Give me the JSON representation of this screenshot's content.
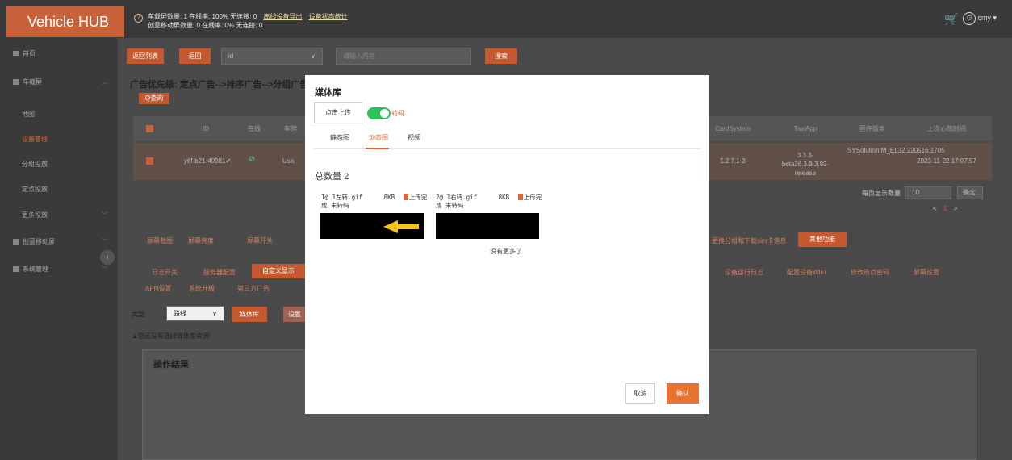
{
  "header": {
    "brand": "Vehicle HUB",
    "stats_line1_text": "车载屏数量: 1  在线率: 100%  无连接: 0",
    "stats_line1_link1": "离线设备导出",
    "stats_line1_link2": "设备状态统计",
    "stats_line2": "创意移动屏数量: 0  在线率: 0%  无连接: 0",
    "user_name": "cmy"
  },
  "sidebar": {
    "items": [
      {
        "label": "首页"
      },
      {
        "label": "车载屏"
      },
      {
        "label": "地图"
      },
      {
        "label": "设备管理"
      },
      {
        "label": "分组投放"
      },
      {
        "label": "定点投放"
      },
      {
        "label": "更多投放"
      },
      {
        "label": "创意移动屏"
      },
      {
        "label": "系统管理"
      }
    ]
  },
  "toolbar": {
    "reset_label": "返回列表",
    "back_label": "返回",
    "field_select": "id",
    "search_placeholder": "请输入内容",
    "search_label": "搜索"
  },
  "main": {
    "title": "广告优先级: 定点广告-->排序广告-->分组广告",
    "query_tag": "Q查询",
    "columns": [
      "ID",
      "在线",
      "车牌",
      "CardSystem",
      "TaxiApp",
      "固件版本",
      "上次心跳时间"
    ],
    "row": {
      "id": "y6f-b21-40981✔",
      "plate": "Usa",
      "card_system": "5.2.7.1-3",
      "taxi_app": "3.3.3-beta26.3.9.3.93-release",
      "firmware": "SYSolution.M_EL32.220516.1705",
      "heartbeat": "2023-11-22 17:07:57"
    },
    "pager": {
      "per_page_label": "每页显示数量",
      "per_page_value": "10",
      "confirm_label": "确定",
      "page": "1"
    },
    "tool_tabs": [
      "屏幕截图",
      "屏幕亮度",
      "屏幕开关",
      "更换分组和下载sim卡信息",
      "其他功能"
    ],
    "actions_row1": [
      "日志开关",
      "服务器配置",
      "自定义显示",
      "设备运行日志",
      "配置设备WIFI",
      "修改热点密码",
      "屏幕设置"
    ],
    "actions_row2": [
      "APN设置",
      "系统升级",
      "第三方广告"
    ],
    "type_label": "类型:",
    "type_value": "路线",
    "media_btn": "媒体库",
    "set_btn": "设置",
    "warning": "▲您还没有选择媒体库资源!",
    "result_title": "操作结果"
  },
  "modal": {
    "title": "媒体库",
    "upload_label": "点击上传",
    "toggle_label": "转码",
    "tabs": [
      {
        "label": "静态图",
        "active": false
      },
      {
        "label": "动态图",
        "active": true
      },
      {
        "label": "视频",
        "active": false
      }
    ],
    "total_label": "总数量",
    "total_value": "2",
    "items": [
      {
        "name": "1@ 1左转.gif",
        "size": "8KB",
        "status": "上传完",
        "transcode": "成 未转码"
      },
      {
        "name": "2@ 1右转.gif",
        "size": "8KB",
        "status": "上传完",
        "transcode": "成 未转码"
      }
    ],
    "no_more": "没有更多了",
    "cancel_label": "取消",
    "ok_label": "确认"
  }
}
